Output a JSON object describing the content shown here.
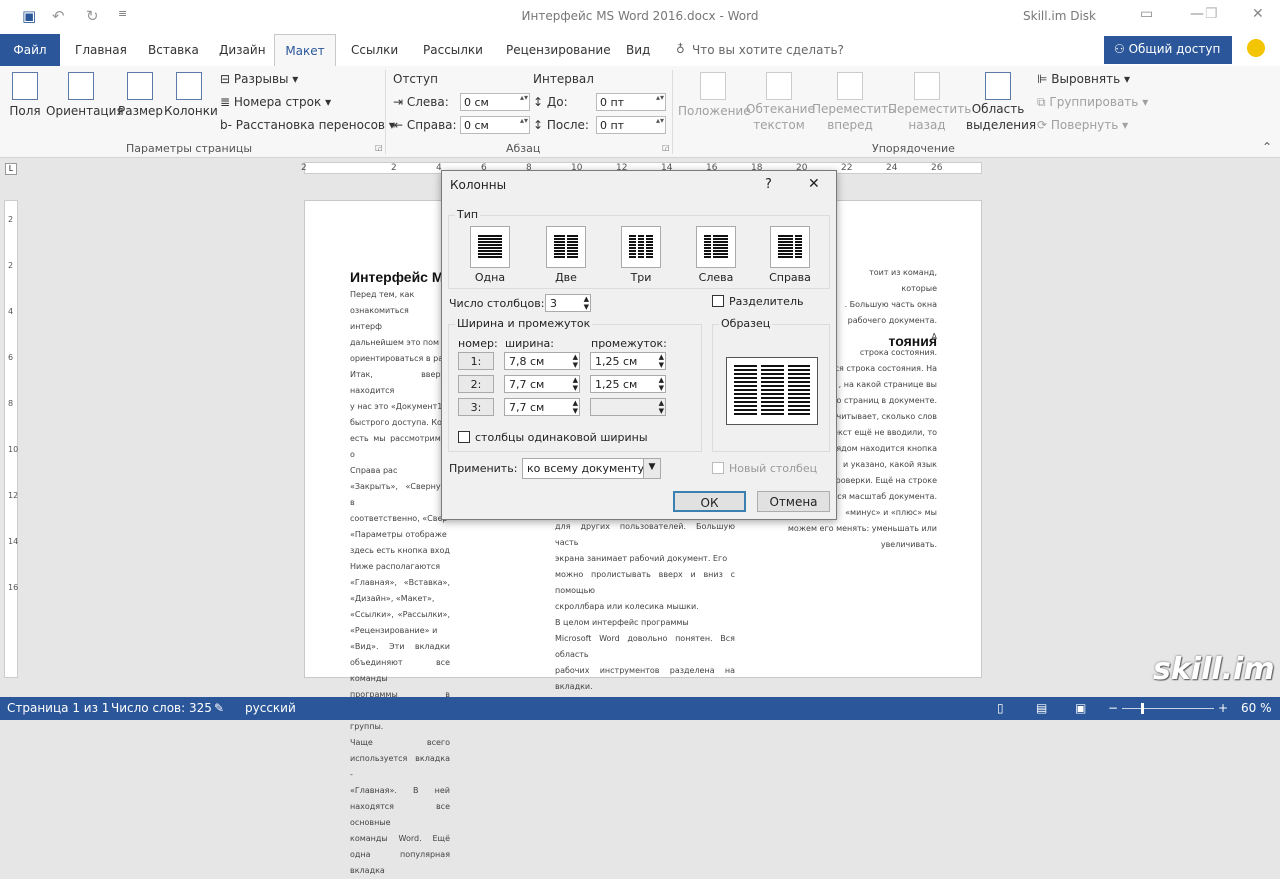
{
  "titlebar": {
    "title": "Интерфейс MS Word 2016.docx - Word",
    "cloud": "Skill.im Disk",
    "save_icon": "save-icon",
    "undo_icon": "undo-icon",
    "redo_icon": "redo-icon"
  },
  "tabs": {
    "file": "Файл",
    "home": "Главная",
    "insert": "Вставка",
    "design": "Дизайн",
    "layout": "Макет",
    "refs": "Ссылки",
    "mailings": "Рассылки",
    "review": "Рецензирование",
    "view": "Вид",
    "tellme": "Что вы хотите сделать?",
    "share": "Общий доступ"
  },
  "ribbon": {
    "fields": "Поля",
    "orientation": "Ориентация",
    "size": "Размер",
    "columns": "Колонки",
    "breaks": "Разрывы",
    "line_numbers": "Номера строк",
    "hyphenation": "Расстановка переносов",
    "group_page": "Параметры страницы",
    "indent": "Отступ",
    "left": "Слева:",
    "right": "Справа:",
    "indent_left": "0 см",
    "indent_right": "0 см",
    "spacing": "Интервал",
    "before": "До:",
    "after": "После:",
    "spacing_before": "0 пт",
    "spacing_after": "0 пт",
    "group_paragraph": "Абзац",
    "position": "Положение",
    "wrap": "Обтекание",
    "wrap2": "текстом",
    "forward": "Переместить",
    "forward2": "вперед",
    "backward": "Переместить",
    "backward2": "назад",
    "selection": "Область",
    "selection2": "выделения",
    "align": "Выровнять",
    "group": "Группировать",
    "rotate": "Повернуть",
    "group_arrange": "Упорядочение"
  },
  "ruler": [
    "2",
    "2",
    "4",
    "6",
    "8",
    "10",
    "12",
    "14",
    "16",
    "18",
    "20",
    "22",
    "24",
    "26"
  ],
  "vruler": [
    "2",
    "2",
    "4",
    "6",
    "8",
    "10",
    "12",
    "14",
    "16"
  ],
  "document": {
    "col1_title": "Интерфейс M",
    "col1": [
      "Перед тем, как",
      "ознакомиться с интерф",
      "дальнейшем это пом",
      "ориентироваться в ра",
      "Итак, вверху находится",
      "у нас это «Документ1».",
      "быстрого доступа. Ком",
      "есть мы рассмотрим в о",
      "Справа рас",
      "«Закрыть», «Свернуть в",
      "соответственно, «Свер",
      "«Параметры отображе",
      "здесь есть кнопка вход",
      "Ниже располагаются",
      "«Главная», «Вставка», «Дизайн», «Макет»,",
      "«Ссылки», «Рассылки», «Рецензирование» и",
      "«Вид». Эти вкладки объединяют все команды",
      "программы в логически связанные группы.",
      "Чаще всего используется вкладка -",
      "«Главная». В ней находятся все основные",
      "команды Word. Ещё одна популярная вкладка"
    ],
    "col2": [
      "для других пользователей. Большую часть",
      "экрана занимает рабочий документ. Его",
      "можно пролистывать вверх и вниз с помощью",
      "скроллбара или колесика мышки.",
      "В целом интерфейс программы",
      "Microsoft Word довольно понятен. Вся область",
      "рабочих инструментов разделена на вкладки."
    ],
    "col3_title": "тояния",
    "col3a": [
      "тоит из команд, которые",
      ". Большую часть окна",
      " рабочего документа. А",
      "строка состояния."
    ],
    "col3b": [
      "ится строка состояния. На",
      ", на какой странице вы",
      "ко страниц в документе.",
      "дсчитывает, сколько слов",
      "текст ещё не вводили, то",
      "Рядом находится кнопка",
      "и указано, какой язык",
      "роверки. Ещё на строке",
      "ется масштаб документа.",
      "«минус» и «плюс» мы",
      "можем его менять: уменьшать или",
      "увеличивать."
    ]
  },
  "dialog": {
    "title": "Колонны",
    "help": "?",
    "close": "✕",
    "type_label": "Тип",
    "presets": [
      "Одна",
      "Две",
      "Три",
      "Слева",
      "Справа"
    ],
    "num_cols_label": "Число столбцов:",
    "num_cols": "3",
    "separator": "Разделитель",
    "wh_label": "Ширина и промежуток",
    "h_num": "номер:",
    "h_width": "ширина:",
    "h_spacing": "промежуток:",
    "rows": [
      {
        "n": "1:",
        "w": "7,8 см",
        "s": "1,25 см"
      },
      {
        "n": "2:",
        "w": "7,7 см",
        "s": "1,25 см"
      },
      {
        "n": "3:",
        "w": "7,7 см",
        "s": ""
      }
    ],
    "equal": "столбцы одинаковой ширины",
    "preview_label": "Образец",
    "apply_label": "Применить:",
    "apply_value": "ко всему документу",
    "new_col": "Новый столбец",
    "ok": "ОК",
    "cancel": "Отмена"
  },
  "status": {
    "page": "Страница 1 из 1",
    "words": "Число слов: 325",
    "lang": "русский",
    "zoom": "60 %"
  },
  "watermark": "skill.im"
}
